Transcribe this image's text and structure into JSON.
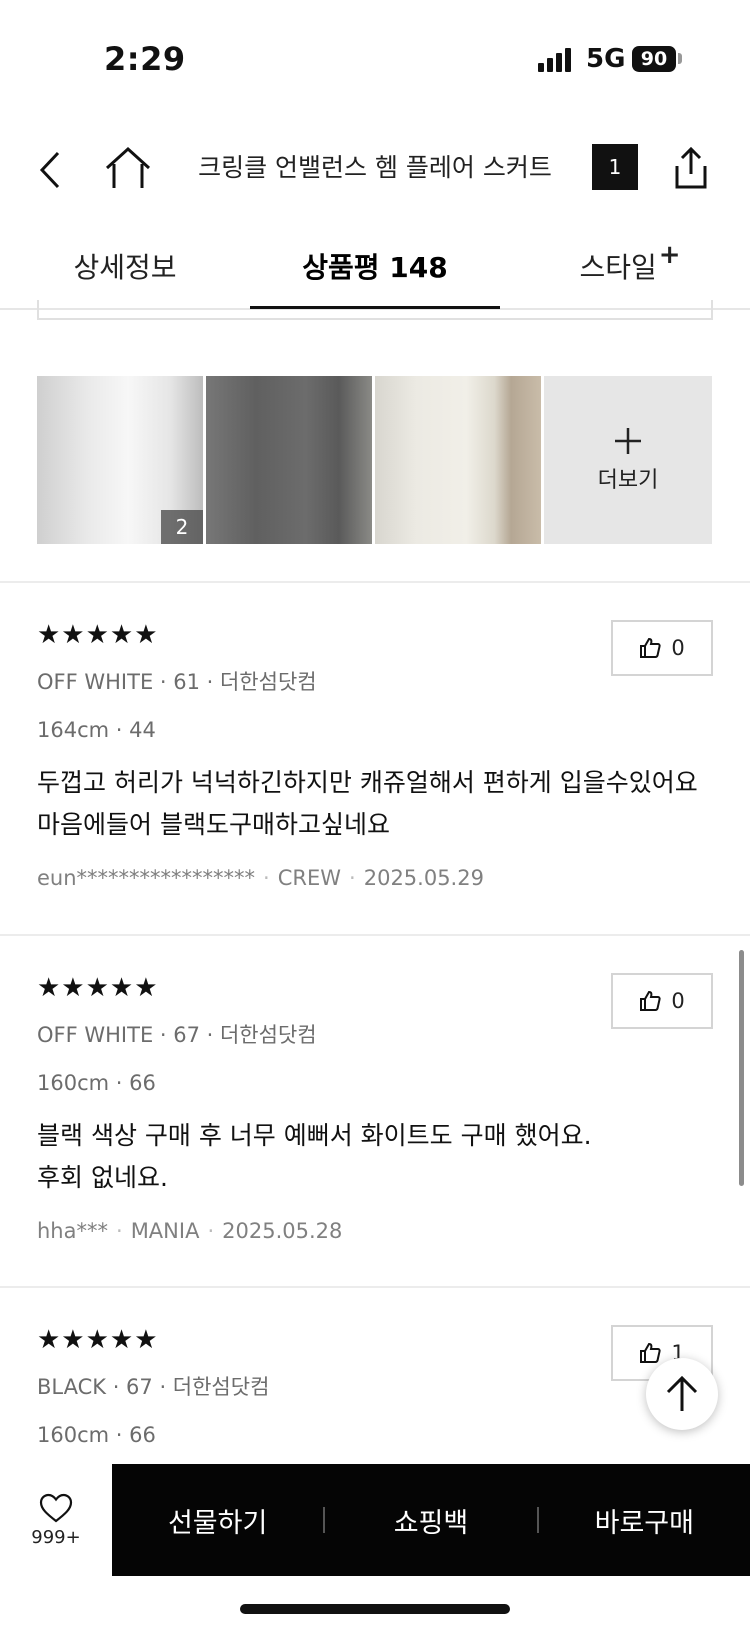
{
  "status": {
    "time": "2:29",
    "network": "5G",
    "battery": "90"
  },
  "header": {
    "title": "크링클 언밸런스 헴 플레어 스커트",
    "cart_count": "1"
  },
  "tabs": [
    {
      "label": "상세정보"
    },
    {
      "label": "상품평 148"
    },
    {
      "label": "스타일",
      "suffix": "+"
    }
  ],
  "photos": {
    "first_count": "2",
    "more_label": "더보기"
  },
  "reviews": [
    {
      "stars": "★★★★★",
      "likes": "0",
      "meta": "OFF WHITE · 61 · 더한섬닷컴",
      "body": "164cm · 44",
      "content": [
        "두껍고 허리가 넉넉하긴하지만 캐쥬얼해서 편하게 입을수있어요",
        "마음에들어 블랙도구매하고싶네요"
      ],
      "user": "eun*****************",
      "grade": "CREW",
      "date": "2025.05.29"
    },
    {
      "stars": "★★★★★",
      "likes": "0",
      "meta": "OFF WHITE · 67 · 더한섬닷컴",
      "body": "160cm · 66",
      "content": [
        "블랙 색상 구매 후 너무 예뻐서 화이트도 구매 했어요.",
        "후회 없네요."
      ],
      "user": "hha***",
      "grade": "MANIA",
      "date": "2025.05.28"
    },
    {
      "stars": "★★★★★",
      "likes": "1",
      "meta": "BLACK · 67 · 더한섬닷컴",
      "body": "160cm · 66"
    }
  ],
  "bottom": {
    "wish_count": "999+",
    "gift": "선물하기",
    "bag": "쇼핑백",
    "buy": "바로구매"
  }
}
